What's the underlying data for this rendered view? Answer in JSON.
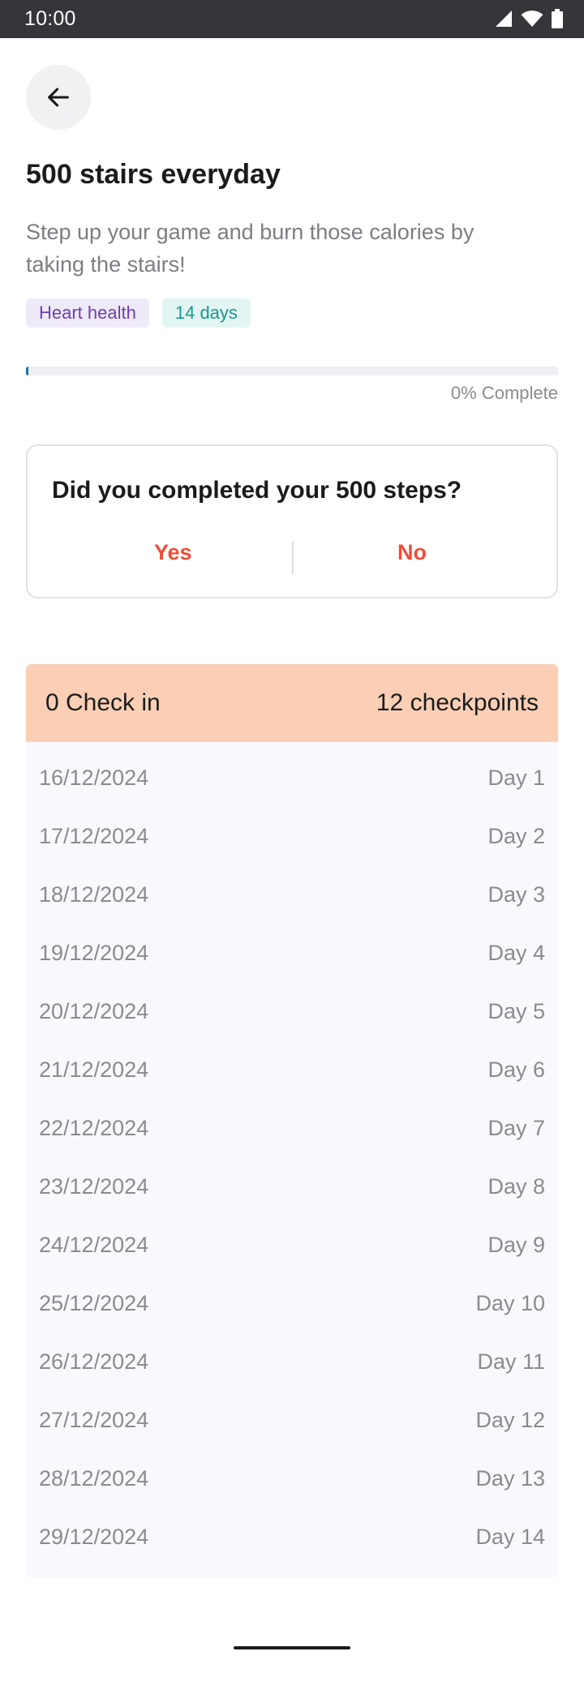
{
  "status_bar": {
    "time": "10:00",
    "icons": [
      "signal-icon",
      "wifi-icon",
      "battery-icon"
    ]
  },
  "header": {
    "back_icon": "arrow-left-icon"
  },
  "challenge": {
    "title": "500 stairs everyday",
    "description": "Step up your game and burn those calories by taking the stairs!",
    "tags": [
      {
        "label": "Heart health",
        "color": "#6b3fb0"
      },
      {
        "label": "14 days",
        "color": "#169a8d"
      }
    ],
    "progress_percent": 0,
    "progress_label": "0% Complete"
  },
  "question_card": {
    "question": "Did you completed your 500 steps?",
    "yes_label": "Yes",
    "no_label": "No",
    "accent_color": "#ef4e38"
  },
  "checkins": {
    "count_label": "0 Check in",
    "checkpoints_label": "12 checkpoints",
    "header_color": "#fbcfb5",
    "days": [
      {
        "date": "16/12/2024",
        "day": "Day 1"
      },
      {
        "date": "17/12/2024",
        "day": "Day 2"
      },
      {
        "date": "18/12/2024",
        "day": "Day 3"
      },
      {
        "date": "19/12/2024",
        "day": "Day 4"
      },
      {
        "date": "20/12/2024",
        "day": "Day 5"
      },
      {
        "date": "21/12/2024",
        "day": "Day 6"
      },
      {
        "date": "22/12/2024",
        "day": "Day 7"
      },
      {
        "date": "23/12/2024",
        "day": "Day 8"
      },
      {
        "date": "24/12/2024",
        "day": "Day 9"
      },
      {
        "date": "25/12/2024",
        "day": "Day 10"
      },
      {
        "date": "26/12/2024",
        "day": "Day 11"
      },
      {
        "date": "27/12/2024",
        "day": "Day 12"
      },
      {
        "date": "28/12/2024",
        "day": "Day 13"
      },
      {
        "date": "29/12/2024",
        "day": "Day 14"
      }
    ]
  }
}
